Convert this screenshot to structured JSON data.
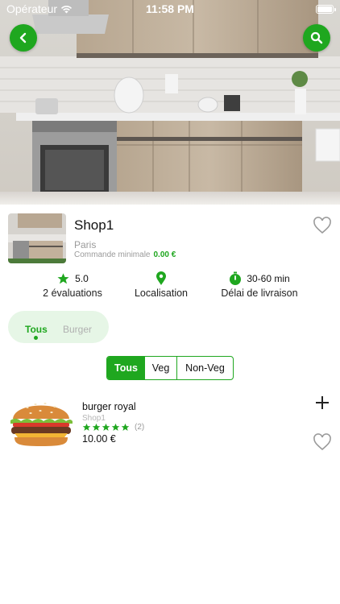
{
  "status_bar": {
    "carrier": "Opérateur",
    "time": "11:58 PM"
  },
  "colors": {
    "accent": "#1fa71f",
    "muted": "#9a9a9a"
  },
  "shop": {
    "name": "Shop1",
    "city": "Paris",
    "min_order_label": "Commande minimale",
    "min_order_value": "0.00 €"
  },
  "info": {
    "rating": "5.0",
    "reviews": "2 évaluations",
    "location_label": "Localisation",
    "delivery_time": "30-60 min",
    "delivery_label": "Délai de livraison"
  },
  "categories": [
    {
      "label": "Tous",
      "active": true
    },
    {
      "label": "Burger",
      "active": false
    }
  ],
  "filters": [
    {
      "label": "Tous",
      "active": true
    },
    {
      "label": "Veg",
      "active": false
    },
    {
      "label": "Non-Veg",
      "active": false
    }
  ],
  "products": [
    {
      "name": "burger royal",
      "shop": "Shop1",
      "rating": 5,
      "reviews": "(2)",
      "price": "10.00 €"
    }
  ],
  "icons": {
    "back": "chevron-left-icon",
    "search": "search-icon",
    "favorite": "heart-outline-icon",
    "rating": "star-icon",
    "location": "map-pin-icon",
    "delivery": "stopwatch-icon",
    "add": "plus-icon"
  }
}
